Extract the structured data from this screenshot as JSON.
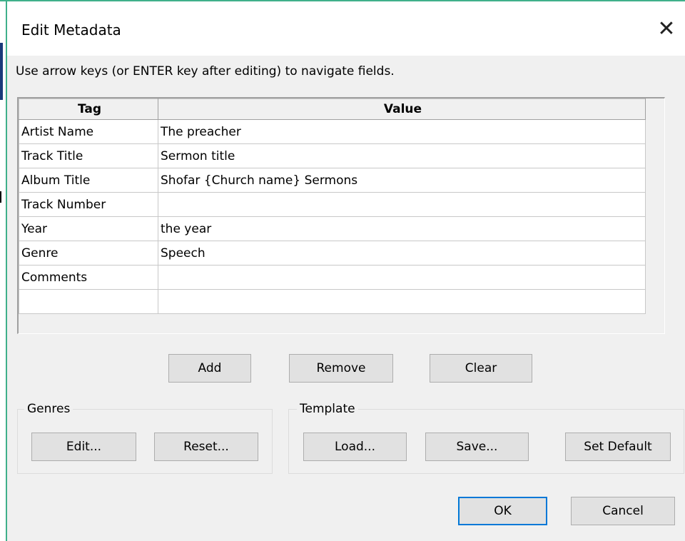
{
  "dialog": {
    "title": "Edit Metadata",
    "instructions": "Use arrow keys (or ENTER key after editing) to navigate fields."
  },
  "grid": {
    "headers": [
      "Tag",
      "Value"
    ],
    "rows": [
      {
        "tag": "Artist Name",
        "value": "The preacher"
      },
      {
        "tag": "Track Title",
        "value": "Sermon title"
      },
      {
        "tag": "Album Title",
        "value": "Shofar {Church name} Sermons"
      },
      {
        "tag": "Track Number",
        "value": ""
      },
      {
        "tag": "Year",
        "value": "the year"
      },
      {
        "tag": "Genre",
        "value": "Speech"
      },
      {
        "tag": "Comments",
        "value": ""
      },
      {
        "tag": "",
        "value": ""
      }
    ]
  },
  "row_buttons": {
    "add": "Add",
    "remove": "Remove",
    "clear": "Clear"
  },
  "genres": {
    "label": "Genres",
    "edit": "Edit...",
    "reset": "Reset..."
  },
  "template": {
    "label": "Template",
    "load": "Load...",
    "save": "Save...",
    "set_default": "Set Default"
  },
  "footer": {
    "ok": "OK",
    "cancel": "Cancel"
  },
  "icons": {
    "close": "close-icon"
  },
  "colors": {
    "accent": "#3fb08a",
    "default_button_border": "#0078d7"
  }
}
